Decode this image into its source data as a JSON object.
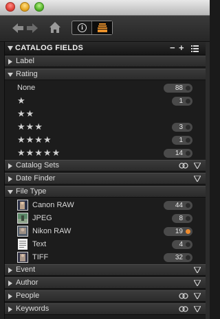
{
  "colors": {
    "accent_active_dot": "#f08c2e",
    "panel_bg": "#1c1c1c",
    "section_bg": "#333333",
    "pill_bg": "#4a4a4a"
  },
  "toolbar": {
    "back_icon": "back-arrow-icon",
    "forward_icon": "forward-arrow-icon",
    "home_icon": "home-icon",
    "info_glyph": "i",
    "catalog_icon": "catalog-icon"
  },
  "panel": {
    "title": "CATALOG FIELDS",
    "minus": "−",
    "plus": "+"
  },
  "sections": {
    "label": "Label",
    "rating": "Rating",
    "catalog_sets": "Catalog Sets",
    "date_finder": "Date Finder",
    "file_type": "File Type",
    "event": "Event",
    "author": "Author",
    "people": "People",
    "keywords": "Keywords"
  },
  "rating_rows": [
    {
      "label": "None",
      "count": "88",
      "has_count": true
    },
    {
      "label": "★",
      "count": "1",
      "has_count": true
    },
    {
      "label": "★★",
      "count": "",
      "has_count": false
    },
    {
      "label": "★★★",
      "count": "3",
      "has_count": true
    },
    {
      "label": "★★★★",
      "count": "1",
      "has_count": true
    },
    {
      "label": "★★★★★",
      "count": "14",
      "has_count": true
    }
  ],
  "file_types": [
    {
      "label": "Canon RAW",
      "count": "44",
      "active": false,
      "thumb": "canon-raw-thumbnail"
    },
    {
      "label": "JPEG",
      "count": "8",
      "active": false,
      "thumb": "jpeg-thumbnail"
    },
    {
      "label": "Nikon RAW",
      "count": "19",
      "active": true,
      "thumb": "nikon-raw-thumbnail"
    },
    {
      "label": "Text",
      "count": "4",
      "active": false,
      "thumb": "text-thumbnail"
    },
    {
      "label": "TIFF",
      "count": "32",
      "active": false,
      "thumb": "tiff-thumbnail"
    }
  ]
}
